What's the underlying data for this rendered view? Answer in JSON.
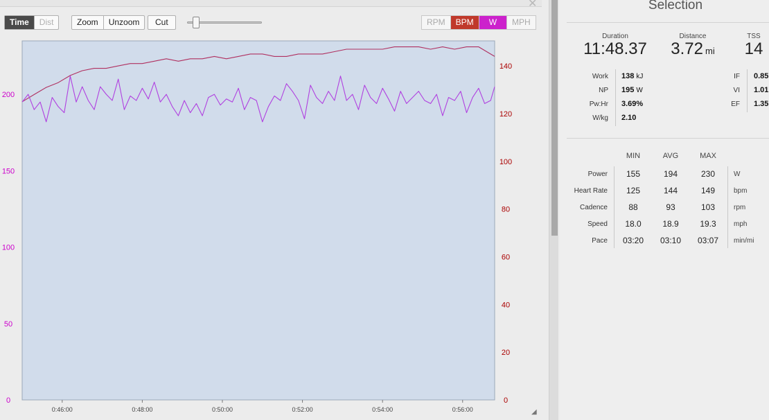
{
  "toolbar": {
    "axis_mode": [
      {
        "label": "Time",
        "active": true
      },
      {
        "label": "Dist",
        "active": false
      }
    ],
    "zoom_label": "Zoom",
    "unzoom_label": "Unzoom",
    "cut_label": "Cut",
    "metrics": [
      {
        "label": "RPM",
        "active": false,
        "bg": "#f6f6f6",
        "fg": "#aaaaaa"
      },
      {
        "label": "BPM",
        "active": true,
        "bg": "#c0392b",
        "fg": "#ffffff"
      },
      {
        "label": "W",
        "active": true,
        "bg": "#cc22cc",
        "fg": "#ffffff"
      },
      {
        "label": "MPH",
        "active": false,
        "bg": "#f6f6f6",
        "fg": "#aaaaaa"
      }
    ]
  },
  "chart_data": {
    "type": "line",
    "x_ticks": [
      "0:46:00",
      "0:48:00",
      "0:50:00",
      "0:52:00",
      "0:54:00",
      "0:56:00"
    ],
    "x_range_min": [
      45.0,
      56.8
    ],
    "left_axis": {
      "ticks": [
        0,
        50,
        100,
        150,
        200
      ],
      "range": [
        0,
        235
      ],
      "color": "#cc00cc"
    },
    "right_axis": {
      "ticks": [
        0,
        20,
        40,
        60,
        80,
        100,
        120,
        140
      ],
      "range": [
        0,
        150.5
      ],
      "color": "#aa0000"
    },
    "background": "#d1dceb",
    "series": [
      {
        "name": "BPM",
        "axis": "right",
        "color": "#b03060",
        "x": [
          45.0,
          45.3,
          45.6,
          45.9,
          46.2,
          46.5,
          46.8,
          47.1,
          47.4,
          47.7,
          48.0,
          48.3,
          48.6,
          48.9,
          49.2,
          49.5,
          49.8,
          50.1,
          50.4,
          50.7,
          51.0,
          51.3,
          51.6,
          51.9,
          52.2,
          52.5,
          52.8,
          53.1,
          53.4,
          53.7,
          54.0,
          54.3,
          54.6,
          54.9,
          55.2,
          55.5,
          55.8,
          56.1,
          56.4,
          56.6,
          56.8
        ],
        "values": [
          125,
          128,
          131,
          133,
          136,
          138,
          139,
          139,
          140,
          141,
          141,
          142,
          143,
          142,
          143,
          143,
          144,
          143,
          144,
          145,
          145,
          144,
          144,
          145,
          145,
          145,
          146,
          147,
          147,
          147,
          147,
          148,
          148,
          148,
          147,
          148,
          147,
          148,
          148,
          146,
          144
        ]
      },
      {
        "name": "W",
        "axis": "left",
        "color": "#b040e0",
        "x": [
          45.0,
          45.15,
          45.3,
          45.45,
          45.6,
          45.75,
          45.9,
          46.05,
          46.2,
          46.35,
          46.5,
          46.65,
          46.8,
          46.95,
          47.1,
          47.25,
          47.4,
          47.55,
          47.7,
          47.85,
          48.0,
          48.15,
          48.3,
          48.45,
          48.6,
          48.75,
          48.9,
          49.05,
          49.2,
          49.35,
          49.5,
          49.65,
          49.8,
          49.95,
          50.1,
          50.25,
          50.4,
          50.55,
          50.7,
          50.85,
          51.0,
          51.15,
          51.3,
          51.45,
          51.6,
          51.75,
          51.9,
          52.05,
          52.2,
          52.35,
          52.5,
          52.65,
          52.8,
          52.95,
          53.1,
          53.25,
          53.4,
          53.55,
          53.7,
          53.85,
          54.0,
          54.15,
          54.3,
          54.45,
          54.6,
          54.75,
          54.9,
          55.05,
          55.2,
          55.35,
          55.5,
          55.65,
          55.8,
          55.95,
          56.1,
          56.25,
          56.4,
          56.55,
          56.7,
          56.8
        ],
        "values": [
          195,
          200,
          190,
          195,
          182,
          198,
          192,
          188,
          212,
          195,
          205,
          196,
          190,
          205,
          200,
          196,
          210,
          190,
          199,
          196,
          204,
          197,
          208,
          195,
          200,
          192,
          186,
          196,
          188,
          194,
          186,
          198,
          200,
          193,
          197,
          195,
          204,
          190,
          198,
          196,
          182,
          192,
          199,
          196,
          207,
          202,
          196,
          184,
          206,
          198,
          194,
          202,
          196,
          212,
          196,
          200,
          190,
          206,
          198,
          194,
          204,
          197,
          189,
          202,
          194,
          198,
          202,
          196,
          194,
          200,
          186,
          198,
          196,
          202,
          188,
          198,
          204,
          194,
          196,
          205
        ]
      }
    ]
  },
  "selection": {
    "title": "Selection",
    "duration_label": "Duration",
    "duration_value": "11:48.37",
    "distance_label": "Distance",
    "distance_value": "3.72",
    "distance_unit": "mi",
    "tss_label": "TSS",
    "tss_value": "14",
    "work_label": "Work",
    "work_value": "138",
    "work_unit": "kJ",
    "np_label": "NP",
    "np_value": "195",
    "np_unit": "W",
    "pwhr_label": "Pw:Hr",
    "pwhr_value": "3.69%",
    "wkg_label": "W/kg",
    "wkg_value": "2.10",
    "if_label": "IF",
    "if_value": "0.85",
    "vi_label": "VI",
    "vi_value": "1.01",
    "ef_label": "EF",
    "ef_value": "1.35",
    "table": {
      "headers": [
        "MIN",
        "AVG",
        "MAX"
      ],
      "rows": [
        {
          "label": "Power",
          "min": "155",
          "avg": "194",
          "max": "230",
          "unit": "W"
        },
        {
          "label": "Heart Rate",
          "min": "125",
          "avg": "144",
          "max": "149",
          "unit": "bpm"
        },
        {
          "label": "Cadence",
          "min": "88",
          "avg": "93",
          "max": "103",
          "unit": "rpm"
        },
        {
          "label": "Speed",
          "min": "18.0",
          "avg": "18.9",
          "max": "19.3",
          "unit": "mph"
        },
        {
          "label": "Pace",
          "min": "03:20",
          "avg": "03:10",
          "max": "03:07",
          "unit": "min/mi"
        }
      ]
    }
  }
}
